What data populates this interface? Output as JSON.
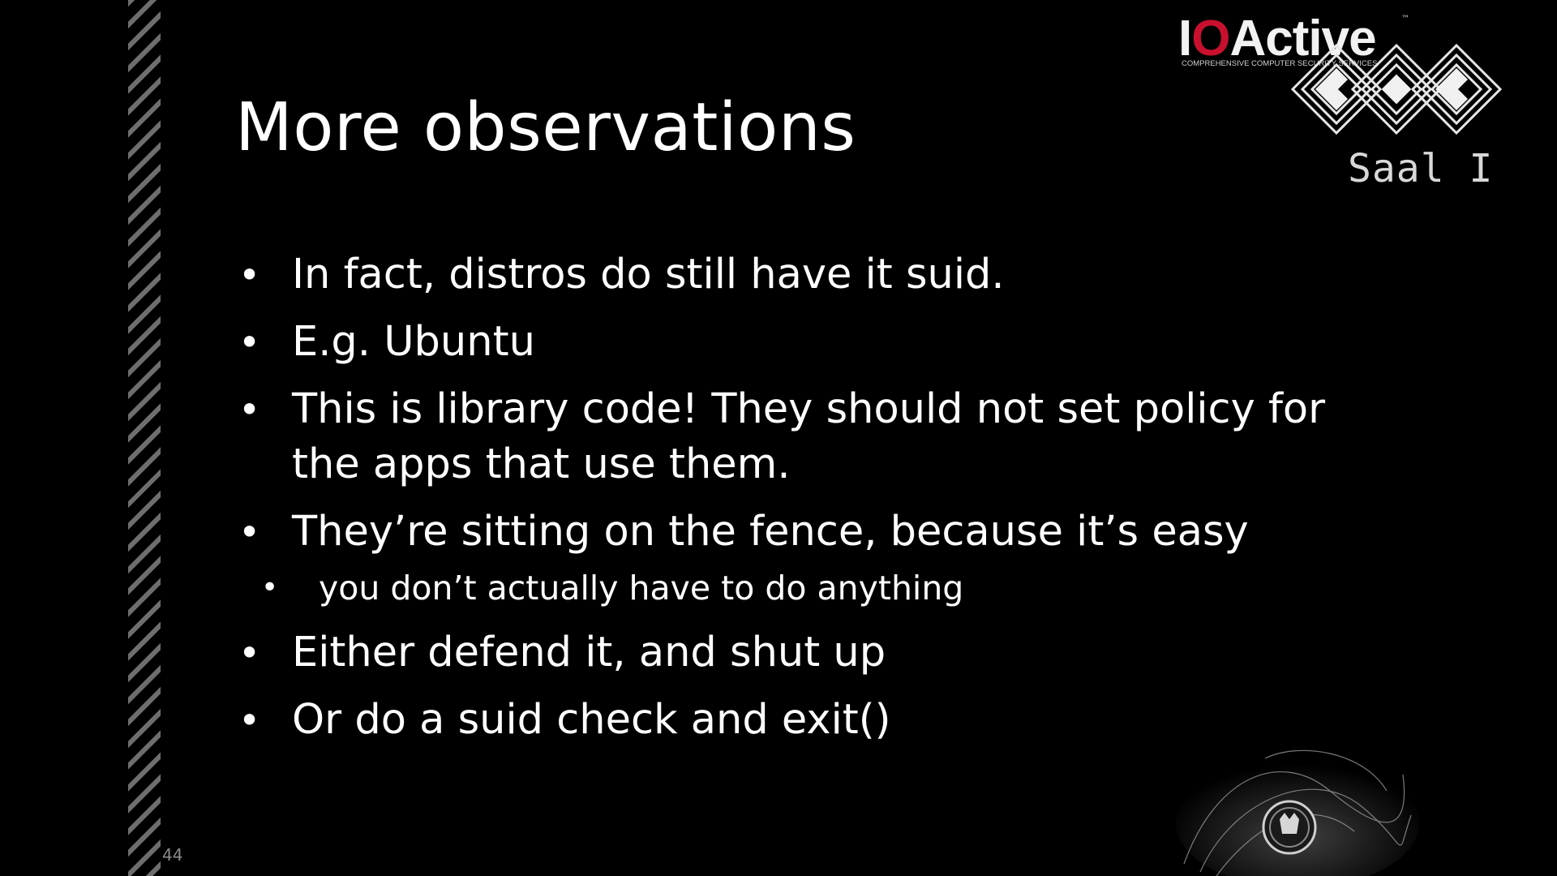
{
  "slide": {
    "title": "More observations",
    "bullets": [
      {
        "text": "In fact, distros do still have it suid.",
        "level": 1
      },
      {
        "text": "E.g. Ubuntu",
        "level": 1
      },
      {
        "text": "This is library code! They should not set policy for the apps that use them.",
        "level": 1
      },
      {
        "text": "They’re sitting on the fence, because it’s easy",
        "level": 1
      },
      {
        "text": "you don’t actually have to do anything",
        "level": 2
      },
      {
        "text": "Either defend it, and shut up",
        "level": 1
      },
      {
        "text": "Or do a suid check and exit()",
        "level": 1
      }
    ],
    "bullet_glyph": "•",
    "page_number": "44"
  },
  "branding": {
    "company_logo": {
      "part1": "I",
      "part2": "O",
      "part3": "Active",
      "tm": "™",
      "tagline": "COMPREHENSIVE COMPUTER SECURITY SERVICES"
    },
    "room_label": "Saal I",
    "accent_color": "#c8102e"
  }
}
